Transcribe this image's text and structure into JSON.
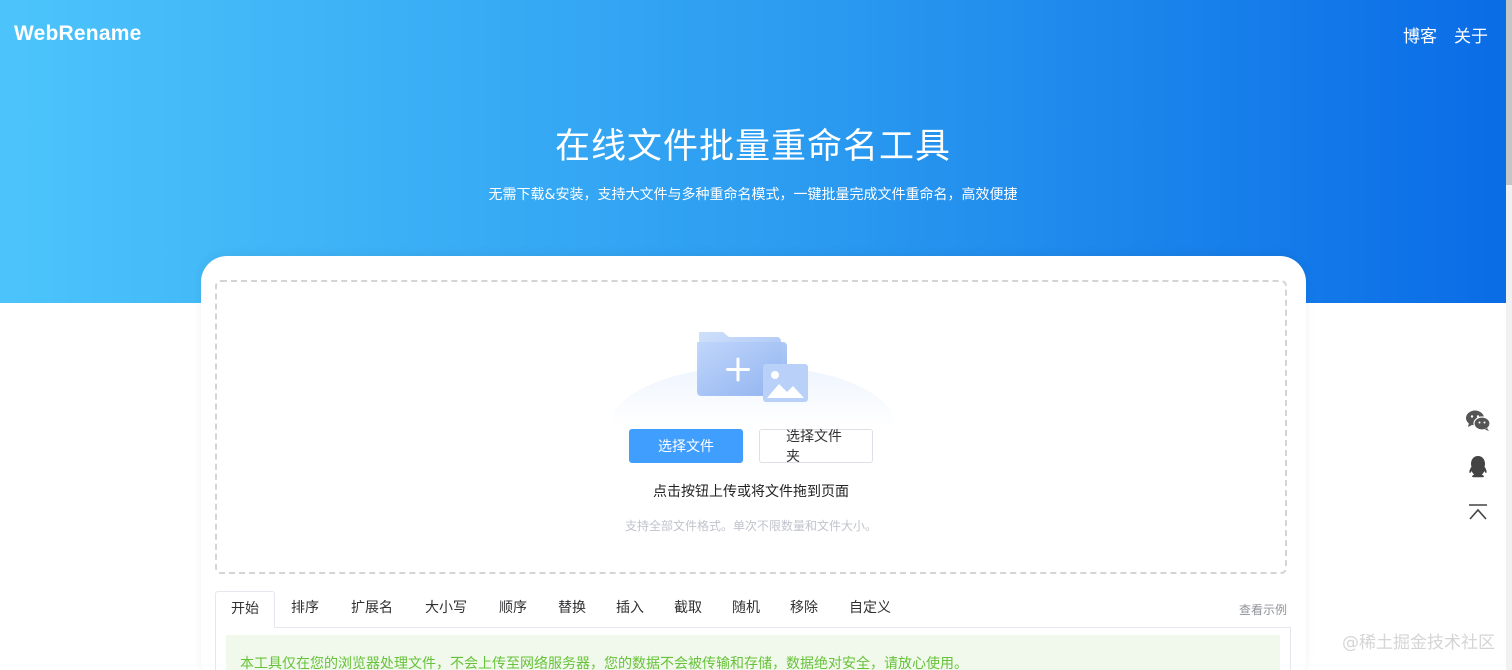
{
  "header": {
    "brand": "WebRename",
    "nav": [
      {
        "label": "博客"
      },
      {
        "label": "关于"
      }
    ]
  },
  "hero": {
    "title": "在线文件批量重命名工具",
    "subtitle": "无需下载&安装，支持大文件与多种重命名模式，一键批量完成文件重命名，高效便捷"
  },
  "upload": {
    "select_files_label": "选择文件",
    "select_folder_label": "选择文件夹",
    "hint": "点击按钮上传或将文件拖到页面",
    "note": "支持全部文件格式。单次不限数量和文件大小。"
  },
  "tabs": {
    "items": [
      {
        "label": "开始"
      },
      {
        "label": "排序"
      },
      {
        "label": "扩展名"
      },
      {
        "label": "大小写"
      },
      {
        "label": "顺序"
      },
      {
        "label": "替换"
      },
      {
        "label": "插入"
      },
      {
        "label": "截取"
      },
      {
        "label": "随机"
      },
      {
        "label": "移除"
      },
      {
        "label": "自定义"
      }
    ],
    "active_index": 0,
    "example_link": "查看示例"
  },
  "notice": "本工具仅在您的浏览器处理文件，不会上传至网络服务器，您的数据不会被传输和存储，数据绝对安全，请放心使用。",
  "floating_tools": [
    {
      "icon": "wechat-icon"
    },
    {
      "icon": "qq-icon"
    },
    {
      "icon": "back-to-top-icon"
    }
  ],
  "watermark": "@稀土掘金技术社区",
  "colors": {
    "primary": "#409eff",
    "hero_gradient_start": "#4cc4fb",
    "hero_gradient_end": "#0a6ce6",
    "notice_bg": "#f0f9eb",
    "notice_text": "#67c23a"
  }
}
